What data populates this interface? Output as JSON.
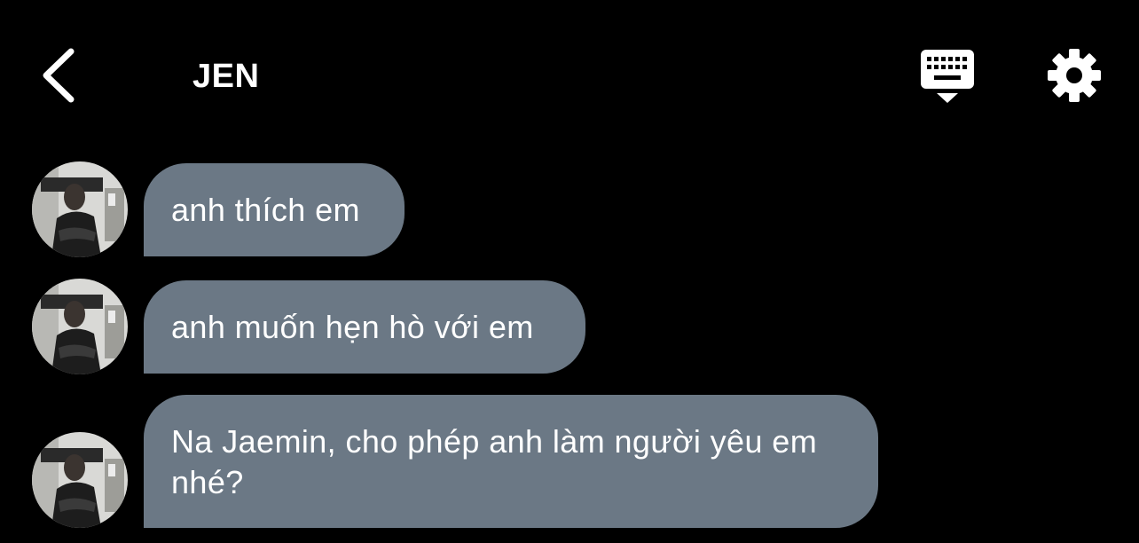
{
  "header": {
    "title": "JEN",
    "back_icon": "chevron-left-icon",
    "keyboard_icon": "keyboard-icon",
    "settings_icon": "gear-icon"
  },
  "colors": {
    "background": "#000000",
    "bubble": "#6b7885",
    "text": "#ffffff"
  },
  "messages": [
    {
      "text": "anh thích em"
    },
    {
      "text": "anh muốn hẹn hò với em"
    },
    {
      "text": "Na Jaemin, cho phép anh làm người yêu em nhé?"
    }
  ]
}
